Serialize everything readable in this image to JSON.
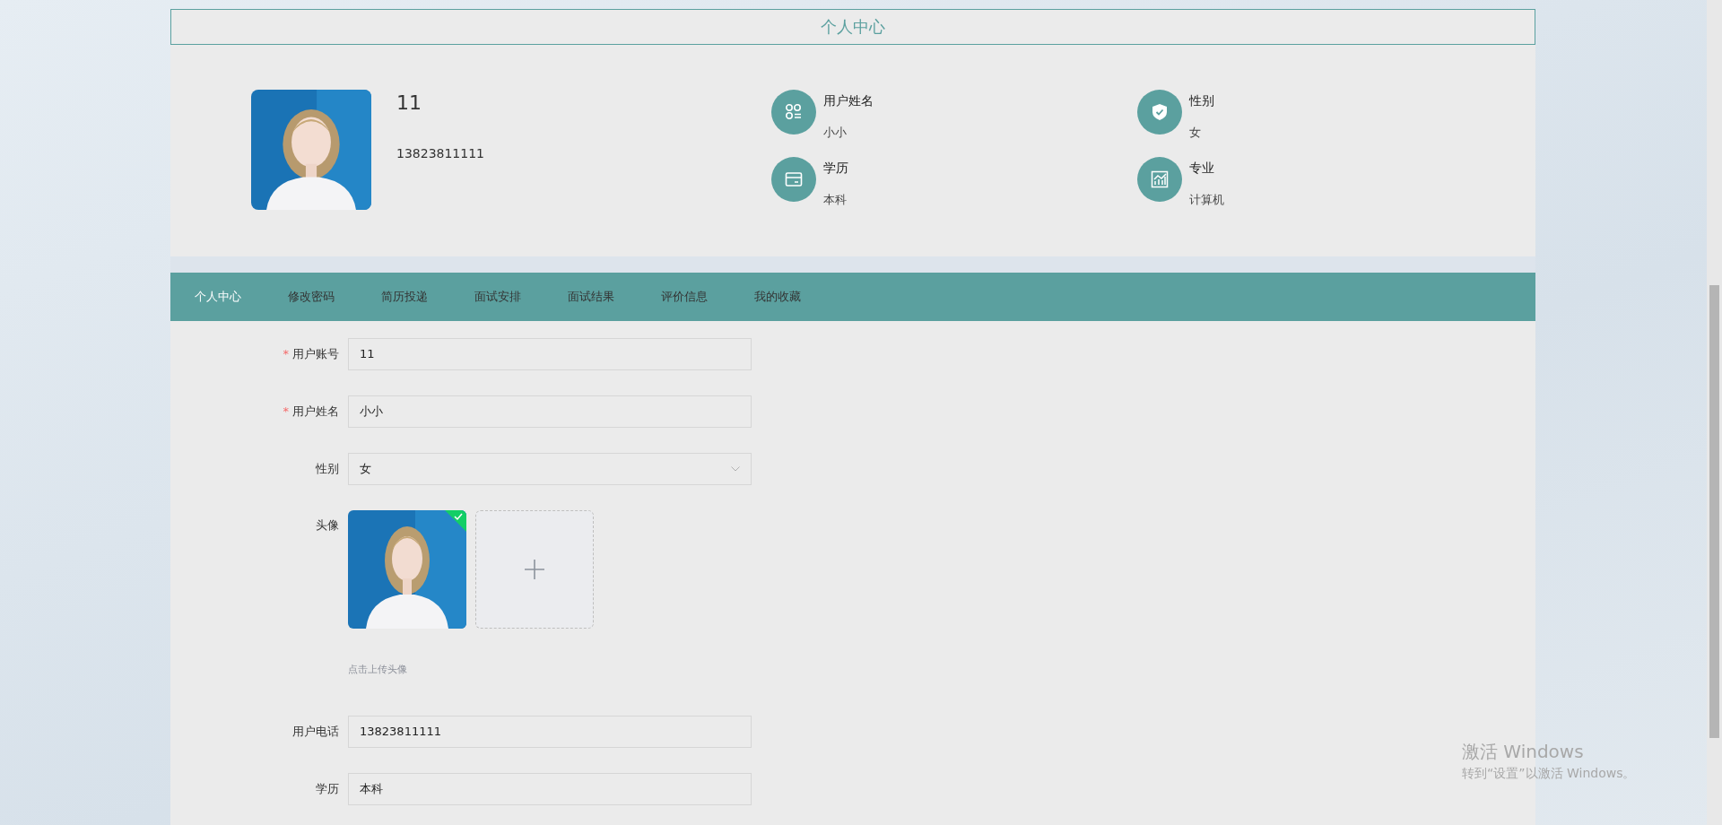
{
  "title": "个人中心",
  "profile": {
    "account": "11",
    "phone": "13823811111",
    "info": [
      {
        "kind": "name",
        "label": "用户姓名",
        "value": "小小"
      },
      {
        "kind": "gender",
        "label": "性别",
        "value": "女"
      },
      {
        "kind": "education",
        "label": "学历",
        "value": "本科"
      },
      {
        "kind": "major",
        "label": "专业",
        "value": "计算机"
      }
    ]
  },
  "tabs": [
    {
      "label": "个人中心",
      "selected": true
    },
    {
      "label": "修改密码",
      "selected": false
    },
    {
      "label": "简历投递",
      "selected": false
    },
    {
      "label": "面试安排",
      "selected": false
    },
    {
      "label": "面试结果",
      "selected": false
    },
    {
      "label": "评价信息",
      "selected": false
    },
    {
      "label": "我的收藏",
      "selected": false
    }
  ],
  "form": [
    {
      "kind": "text",
      "label": "用户账号",
      "required_mark": "*",
      "value": "11"
    },
    {
      "kind": "text",
      "label": "用户姓名",
      "required_mark": "*",
      "value": "小小"
    },
    {
      "kind": "select",
      "label": "性别",
      "value": "女"
    },
    {
      "kind": "upload",
      "label": "头像",
      "uploaded": true,
      "hint": "点击上传头像"
    },
    {
      "kind": "text",
      "label": "用户电话",
      "value": "13823811111"
    },
    {
      "kind": "text",
      "label": "学历",
      "value": "本科"
    }
  ],
  "activation_notice": {
    "title": "激活 Windows",
    "body": "转到“设置”以激活 Windows。"
  }
}
